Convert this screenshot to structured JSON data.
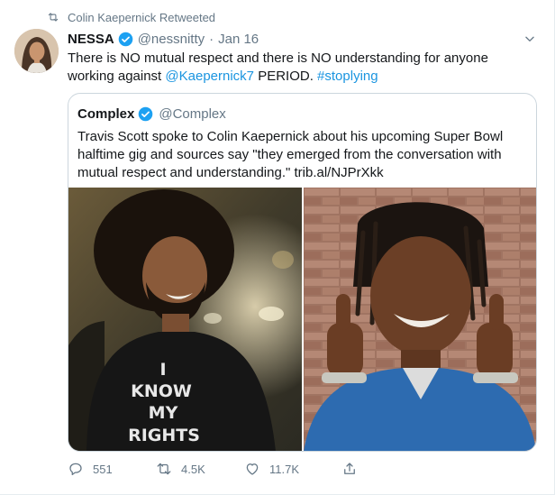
{
  "retweet_context": {
    "text": "Colin Kaepernick Retweeted"
  },
  "author": {
    "name": "NESSA",
    "handle": "@nessnitty",
    "separator": "·",
    "date": "Jan 16"
  },
  "tweet": {
    "text_before": "There is NO mutual respect and there is NO understanding for anyone working against ",
    "mention": "@Kaepernick7",
    "text_middle": " PERIOD. ",
    "hashtag": "#stoplying"
  },
  "quoted_tweet": {
    "name": "Complex",
    "handle": "@Complex",
    "text": "Travis Scott spoke to Colin Kaepernick about his upcoming Super Bowl halftime gig and sources say \"they emerged from the conversation with mutual respect and understanding.\" trib.al/NJPrXkk",
    "shirt_text": [
      "I",
      "KNOW",
      "MY",
      "RIGHTS"
    ]
  },
  "actions": {
    "replies": "551",
    "retweets": "4.5K",
    "likes": "11.7K"
  },
  "colors": {
    "link": "#1b95e0",
    "secondary_text": "#657786",
    "verified": "#1da1f2",
    "border": "#ccd6dd"
  },
  "icons": [
    "retweet-icon",
    "verified-badge-icon",
    "chevron-down-icon",
    "reply-icon",
    "like-icon",
    "share-icon"
  ]
}
